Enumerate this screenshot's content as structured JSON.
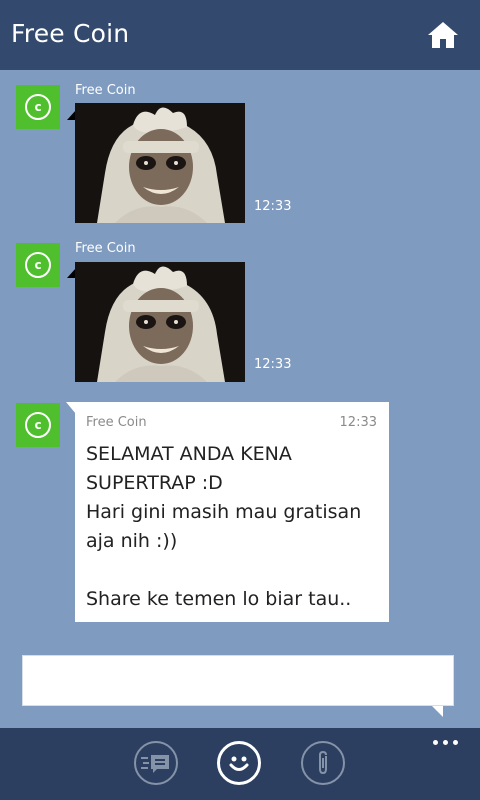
{
  "header": {
    "title": "Free Coin",
    "home_icon": "home-icon"
  },
  "messages": [
    {
      "sender": "Free Coin",
      "time": "12:33",
      "type": "image"
    },
    {
      "sender": "Free Coin",
      "time": "12:33",
      "type": "image"
    },
    {
      "sender": "Free Coin",
      "time": "12:33",
      "type": "text",
      "lines": [
        "SELAMAT ANDA KENA",
        "SUPERTRAP :D",
        "Hari gini masih mau gratisan",
        "aja nih :))",
        "",
        "Share ke temen lo biar tau.."
      ]
    }
  ],
  "avatar_glyph": "c",
  "compose": {
    "value": ""
  },
  "appbar": {
    "buttons": [
      "quick-reply-icon",
      "emoji-icon",
      "attach-icon"
    ],
    "more_icon": "more-dots-icon"
  },
  "colors": {
    "header": "#334a6e",
    "chat_background": "#7f9bc0",
    "appbar": "#2c3f61",
    "avatar": "#4fbf2e"
  }
}
